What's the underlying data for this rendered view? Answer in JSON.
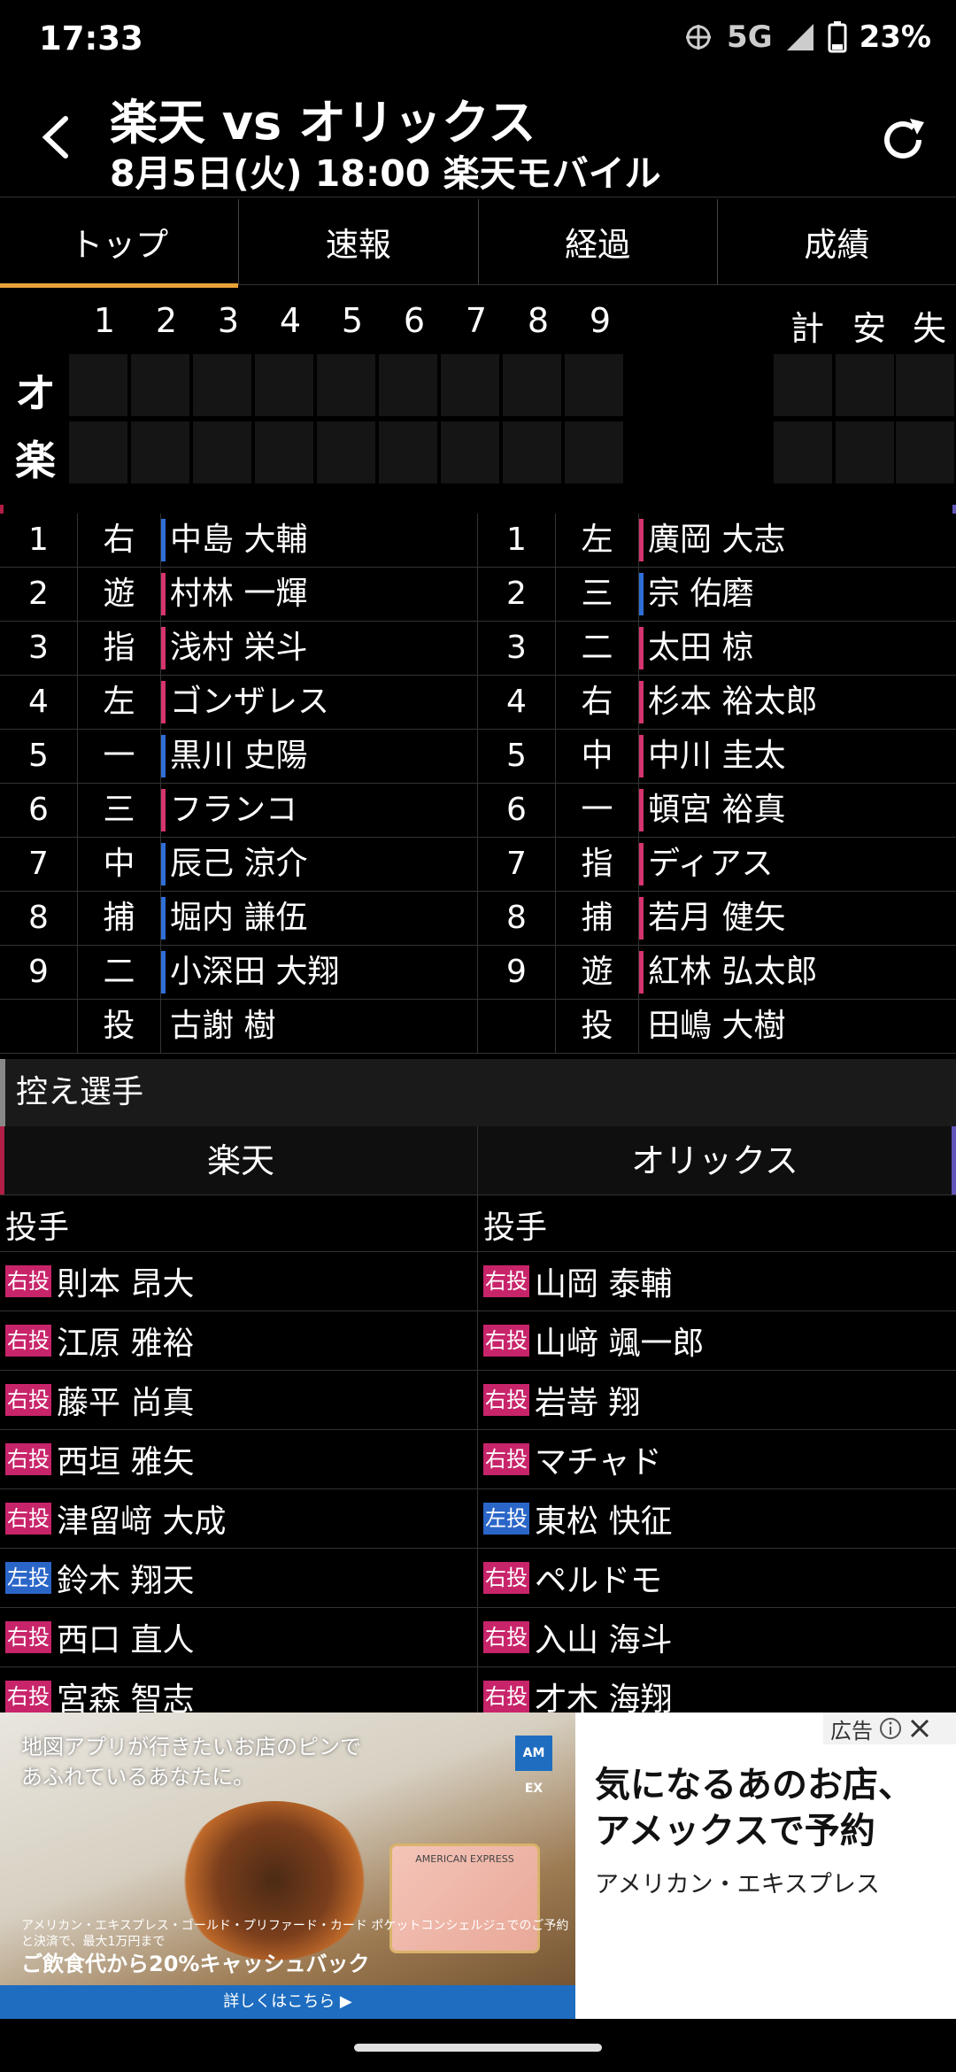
{
  "status_bar": {
    "time": "17:33",
    "network": "5G",
    "battery": "23%"
  },
  "header": {
    "title": "楽天 vs オリックス",
    "subtitle": "8月5日(火) 18:00 楽天モバイル"
  },
  "tabs": [
    {
      "label": "トップ",
      "active": true
    },
    {
      "label": "速報",
      "active": false
    },
    {
      "label": "経過",
      "active": false
    },
    {
      "label": "成績",
      "active": false
    }
  ],
  "scoreboard": {
    "innings": [
      "1",
      "2",
      "3",
      "4",
      "5",
      "6",
      "7",
      "8",
      "9"
    ],
    "totals_headers": [
      "計",
      "安",
      "失"
    ],
    "teams": [
      "オ",
      "楽"
    ]
  },
  "lineup": {
    "left": [
      {
        "order": "1",
        "pos": "右",
        "name": "中島 大輔",
        "hand": "l"
      },
      {
        "order": "2",
        "pos": "遊",
        "name": "村林 一輝",
        "hand": "r"
      },
      {
        "order": "3",
        "pos": "指",
        "name": "浅村 栄斗",
        "hand": "r"
      },
      {
        "order": "4",
        "pos": "左",
        "name": "ゴンザレス",
        "hand": "r"
      },
      {
        "order": "5",
        "pos": "一",
        "name": "黒川 史陽",
        "hand": "l"
      },
      {
        "order": "6",
        "pos": "三",
        "name": "フランコ",
        "hand": "r"
      },
      {
        "order": "7",
        "pos": "中",
        "name": "辰己 涼介",
        "hand": "l"
      },
      {
        "order": "8",
        "pos": "捕",
        "name": "堀内 謙伍",
        "hand": "l"
      },
      {
        "order": "9",
        "pos": "二",
        "name": "小深田 大翔",
        "hand": "l"
      },
      {
        "order": "",
        "pos": "投",
        "name": "古謝 樹",
        "hand": ""
      }
    ],
    "right": [
      {
        "order": "1",
        "pos": "左",
        "name": "廣岡 大志",
        "hand": "r"
      },
      {
        "order": "2",
        "pos": "三",
        "name": "宗 佑磨",
        "hand": "l"
      },
      {
        "order": "3",
        "pos": "二",
        "name": "太田 椋",
        "hand": "r"
      },
      {
        "order": "4",
        "pos": "右",
        "name": "杉本 裕太郎",
        "hand": "r"
      },
      {
        "order": "5",
        "pos": "中",
        "name": "中川 圭太",
        "hand": "r"
      },
      {
        "order": "6",
        "pos": "一",
        "name": "頓宮 裕真",
        "hand": "r"
      },
      {
        "order": "7",
        "pos": "指",
        "name": "ディアス",
        "hand": "r"
      },
      {
        "order": "8",
        "pos": "捕",
        "name": "若月 健矢",
        "hand": "r"
      },
      {
        "order": "9",
        "pos": "遊",
        "name": "紅林 弘太郎",
        "hand": "r"
      },
      {
        "order": "",
        "pos": "投",
        "name": "田嶋 大樹",
        "hand": ""
      }
    ]
  },
  "reserves": {
    "section_title": "控え選手",
    "team_left": "楽天",
    "team_right": "オリックス",
    "group_label": "投手",
    "left": [
      {
        "tag": "右投",
        "hand": "r",
        "name": "則本 昂大"
      },
      {
        "tag": "右投",
        "hand": "r",
        "name": "江原 雅裕"
      },
      {
        "tag": "右投",
        "hand": "r",
        "name": "藤平 尚真"
      },
      {
        "tag": "右投",
        "hand": "r",
        "name": "西垣 雅矢"
      },
      {
        "tag": "右投",
        "hand": "r",
        "name": "津留﨑 大成"
      },
      {
        "tag": "左投",
        "hand": "l",
        "name": "鈴木 翔天"
      },
      {
        "tag": "右投",
        "hand": "r",
        "name": "西口 直人"
      },
      {
        "tag": "右投",
        "hand": "r",
        "name": "宮森 智志"
      }
    ],
    "right": [
      {
        "tag": "右投",
        "hand": "r",
        "name": "山岡 泰輔"
      },
      {
        "tag": "右投",
        "hand": "r",
        "name": "山﨑 颯一郎"
      },
      {
        "tag": "右投",
        "hand": "r",
        "name": "岩嵜 翔"
      },
      {
        "tag": "右投",
        "hand": "r",
        "name": "マチャド"
      },
      {
        "tag": "左投",
        "hand": "l",
        "name": "東松 快征"
      },
      {
        "tag": "右投",
        "hand": "r",
        "name": "ペルドモ"
      },
      {
        "tag": "右投",
        "hand": "r",
        "name": "入山 海斗"
      },
      {
        "tag": "右投",
        "hand": "r",
        "name": "才木 海翔"
      }
    ]
  },
  "ad": {
    "label": "広告",
    "image_copy_line1": "地図アプリが行きたいお店のピンで",
    "image_copy_line2": "あふれているあなたに。",
    "image_small": "アメリカン・エキスプレス・ゴールド・プリファード・カード ポケットコンシェルジュでのご予約と決済で、最大1万円まで",
    "image_big": "ご飲食代から20%キャッシュバック",
    "cta": "詳しくはこちら ▶",
    "card_text": "AMERICAN EXPRESS",
    "headline_line1": "気になるあのお店、",
    "headline_line2": "アメックスで予約",
    "brand": "アメリカン・エキスプレス"
  }
}
